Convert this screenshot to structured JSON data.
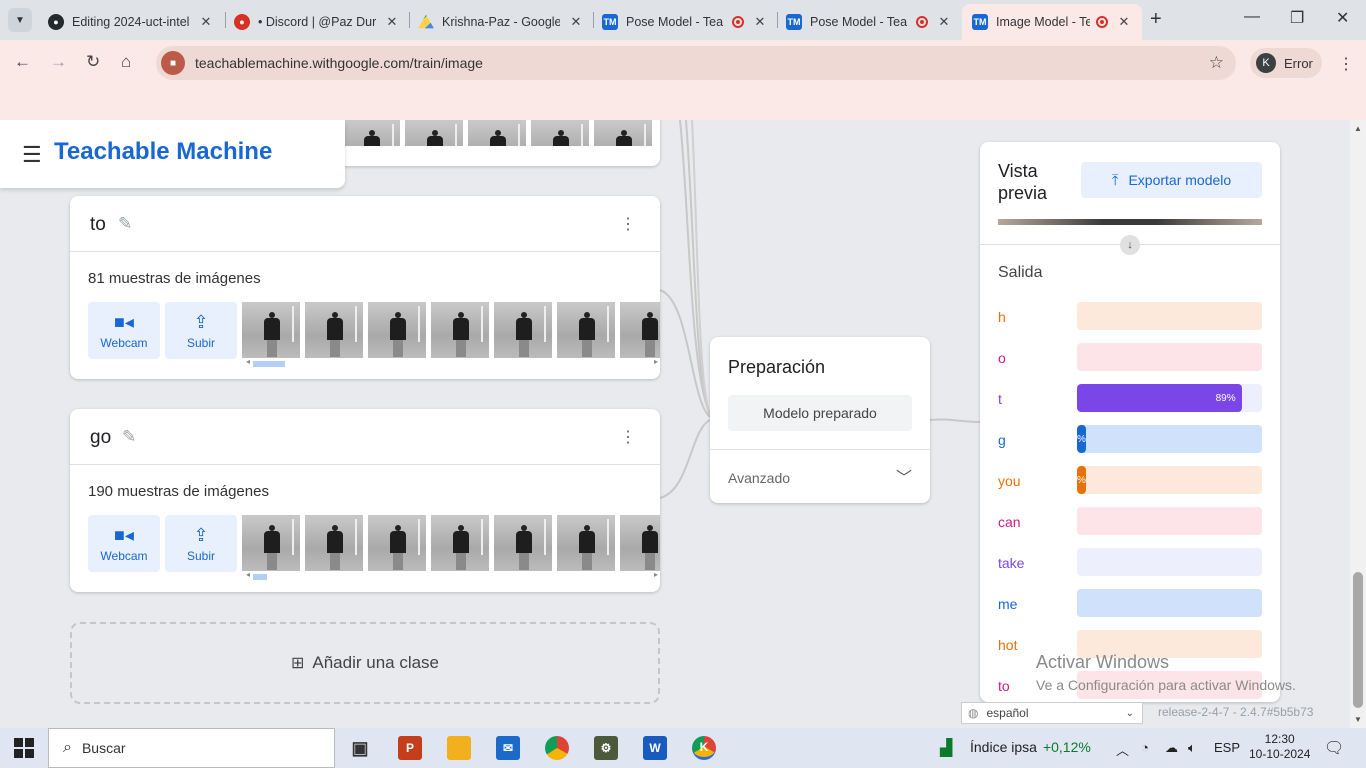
{
  "browser": {
    "tabs": [
      {
        "title": "Editing 2024-uct-intel",
        "favicon": "github-icon",
        "recording": false
      },
      {
        "title": "• Discord | @Paz Dura",
        "favicon": "discord-icon",
        "recording": false
      },
      {
        "title": "Krishna-Paz - Google",
        "favicon": "google-drive-icon",
        "recording": false
      },
      {
        "title": "Pose Model - Tea",
        "favicon": "tm-icon",
        "recording": true
      },
      {
        "title": "Pose Model - Tea",
        "favicon": "tm-icon",
        "recording": true
      },
      {
        "title": "Image Model - Te",
        "favicon": "tm-icon",
        "recording": true,
        "active": true
      }
    ],
    "favicon_text": {
      "tm": "TM"
    },
    "url": "teachablemachine.withgoogle.com/train/image",
    "profile": {
      "initial": "K",
      "label": "Error"
    }
  },
  "app": {
    "brand": "Teachable Machine"
  },
  "classes": [
    {
      "name": "to",
      "samples": "81 muestras de imágenes",
      "webcam": "Webcam",
      "upload": "Subir"
    },
    {
      "name": "go",
      "samples": "190 muestras de imágenes",
      "webcam": "Webcam",
      "upload": "Subir"
    }
  ],
  "add_class": "Añadir una clase",
  "training": {
    "title": "Preparación",
    "button": "Modelo preparado",
    "advanced": "Avanzado"
  },
  "preview": {
    "title": "Vista previa",
    "export": "Exportar modelo",
    "output_label": "Salida",
    "outputs": [
      {
        "label": "h",
        "value": 0,
        "color": "#e8710a",
        "bg": "#fde8dc",
        "text": ""
      },
      {
        "label": "o",
        "value": 0,
        "color": "#d01884",
        "bg": "#fde4e8",
        "text": ""
      },
      {
        "label": "t",
        "value": 0.89,
        "color": "#7b46e8",
        "bg": "#eeeffd",
        "text": "89%"
      },
      {
        "label": "g",
        "value": 0.04,
        "color": "#1967d2",
        "bg": "#cfe1fb",
        "text": "%"
      },
      {
        "label": "you",
        "value": 0.04,
        "color": "#e8710a",
        "bg": "#fde8dc",
        "text": "%"
      },
      {
        "label": "can",
        "value": 0,
        "color": "#d01884",
        "bg": "#fde4e8",
        "text": ""
      },
      {
        "label": "take",
        "value": 0,
        "color": "#7b46e8",
        "bg": "#eeeffd",
        "text": ""
      },
      {
        "label": "me",
        "value": 0,
        "color": "#1967d2",
        "bg": "#cfe1fb",
        "text": ""
      },
      {
        "label": "hot",
        "value": 0,
        "color": "#e8710a",
        "bg": "#fde8dc",
        "text": ""
      },
      {
        "label": "to",
        "value": 0,
        "color": "#d01884",
        "bg": "#fde4e8",
        "text": ""
      }
    ]
  },
  "footer": {
    "language": "español",
    "release": "release-2-4-7 - 2.4.7#5b5b73"
  },
  "watermark": {
    "title": "Activar Windows",
    "subtitle": "Ve a Configuración para activar Windows."
  },
  "taskbar": {
    "search": "Buscar",
    "stock_label": "Índice ipsa",
    "stock_change": "+0,12%",
    "lang": "ESP",
    "time": "12:30",
    "date": "10-10-2024",
    "icons": [
      {
        "name": "task-view-icon",
        "text": "▣",
        "color": "#333"
      },
      {
        "name": "powerpoint-icon",
        "text": "P",
        "color": "#c43e1c"
      },
      {
        "name": "file-explorer-icon",
        "text": "",
        "color": "#f2b01e"
      },
      {
        "name": "mail-icon",
        "text": "✉",
        "color": "#1b6ac9"
      },
      {
        "name": "chrome-icon",
        "text": "",
        "color": "#2e9e4f"
      },
      {
        "name": "app-icon",
        "text": "⚙",
        "color": "#4a5a3a"
      },
      {
        "name": "word-icon",
        "text": "W",
        "color": "#185abd"
      },
      {
        "name": "chrome-profile-icon",
        "text": "K",
        "color": "#1a73e8"
      }
    ]
  }
}
